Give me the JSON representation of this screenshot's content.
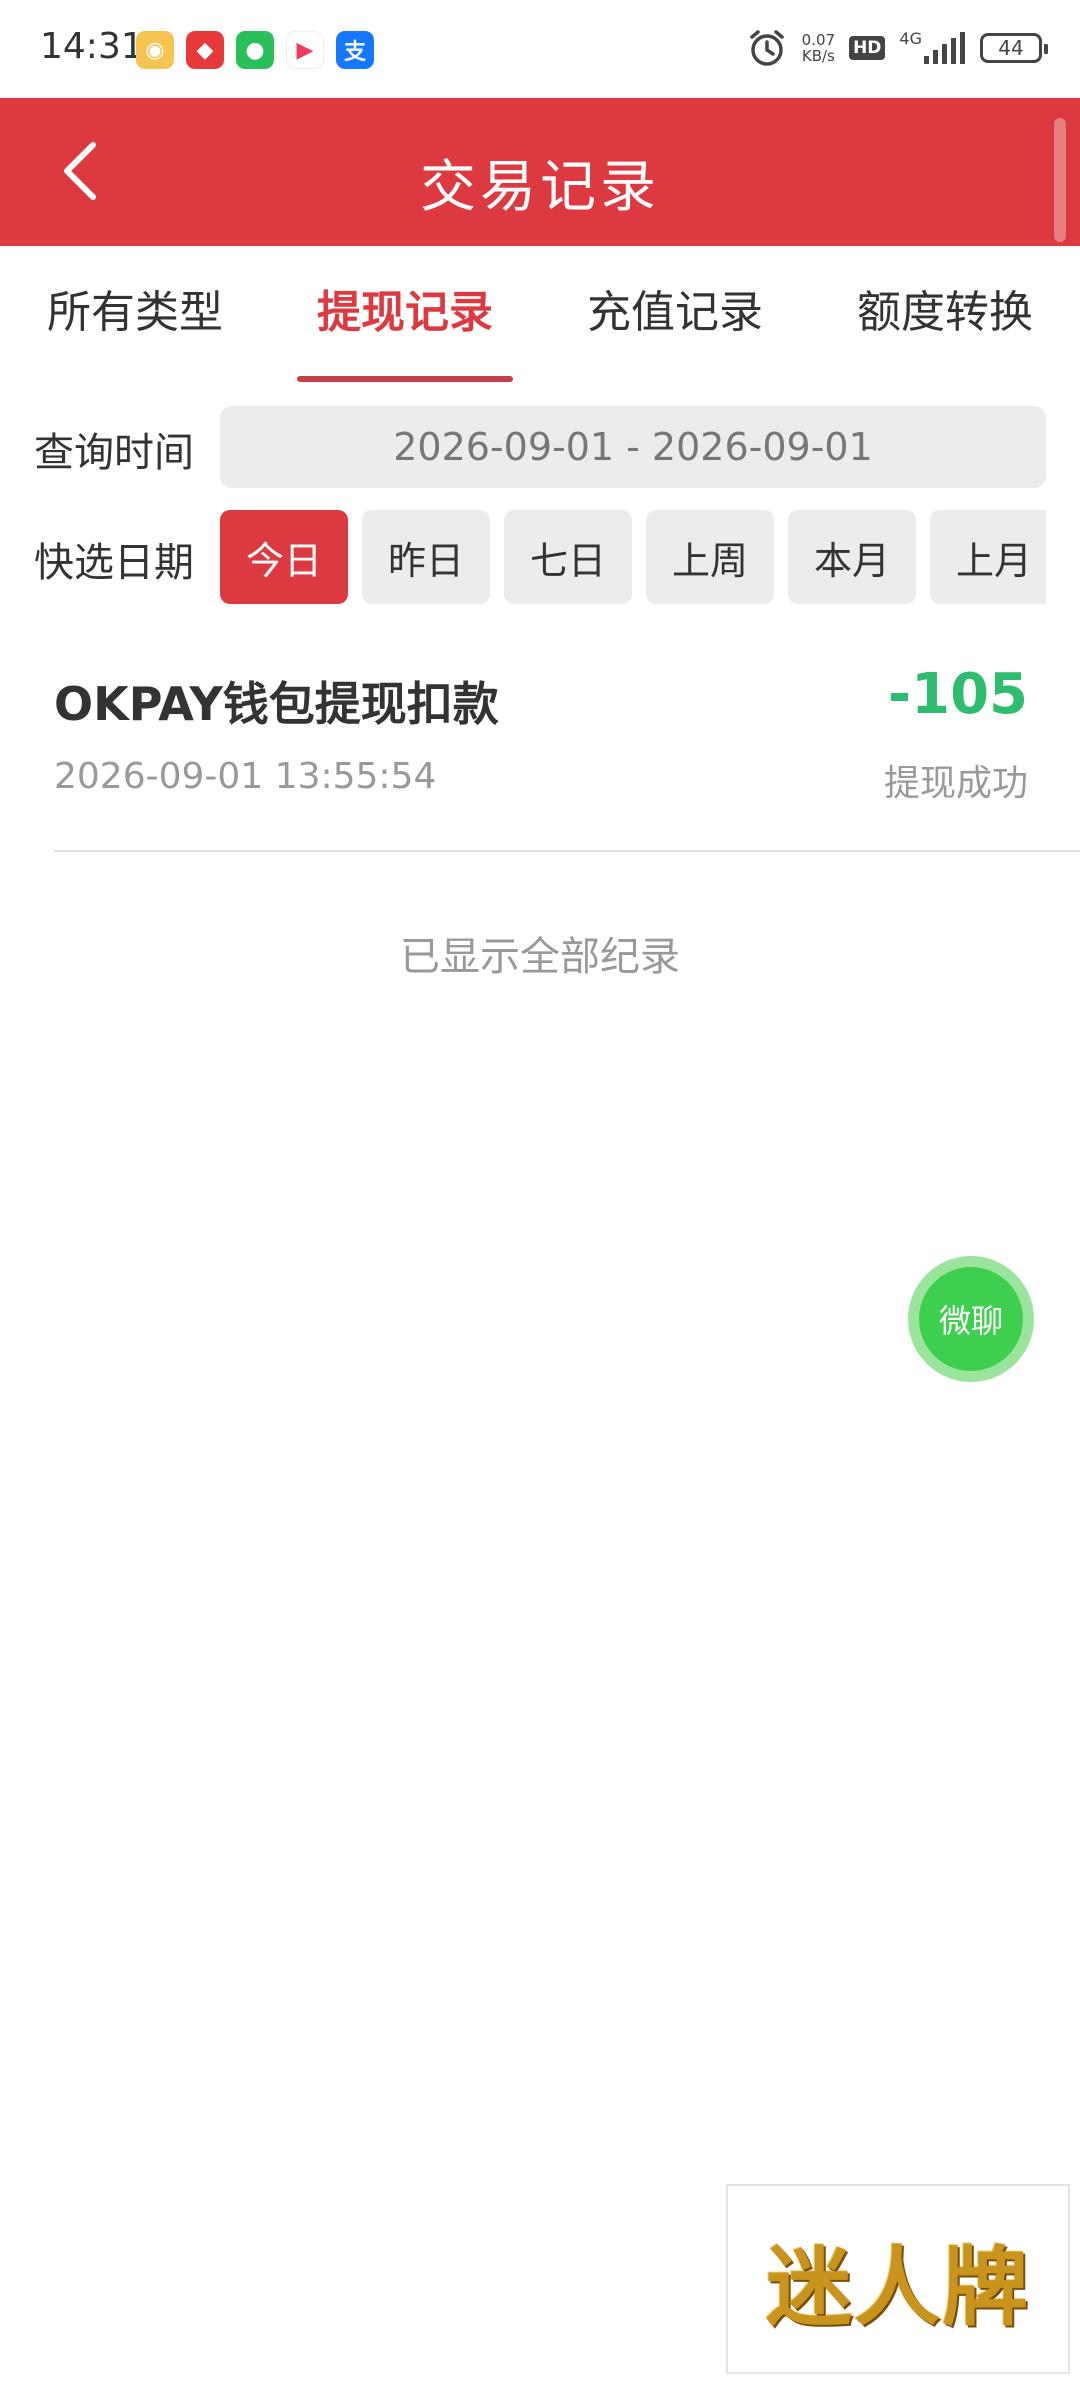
{
  "status_bar": {
    "time": "14:31",
    "apps": [
      {
        "icon": "weibo-icon",
        "color": "#f5c451",
        "glyph": "◉"
      },
      {
        "icon": "tmall-icon",
        "color": "#e8393a",
        "glyph": "◆"
      },
      {
        "icon": "wechat-icon",
        "color": "#29c05a",
        "glyph": "●"
      },
      {
        "icon": "video-app-icon",
        "color": "#f03a5b",
        "glyph": "▶"
      },
      {
        "icon": "alipay-icon",
        "color": "#1678ff",
        "glyph": "支"
      }
    ],
    "net_speed_value": "0.07",
    "net_speed_unit": "KB/s",
    "hd": "HD",
    "network": "4G",
    "battery": "44"
  },
  "header": {
    "title": "交易记录",
    "color": "#dc3a40"
  },
  "tabs": [
    {
      "label": "所有类型",
      "active": false
    },
    {
      "label": "提现记录",
      "active": true
    },
    {
      "label": "充值记录",
      "active": false
    },
    {
      "label": "额度转换",
      "active": false
    }
  ],
  "query": {
    "label": "查询时间",
    "range": "2026-09-01 - 2026-09-01"
  },
  "quick_dates": {
    "label": "快选日期",
    "options": [
      "今日",
      "昨日",
      "七日",
      "上周",
      "本月",
      "上月"
    ],
    "selected": "今日"
  },
  "records": [
    {
      "title": "OKPAY钱包提现扣款",
      "amount": "-105",
      "time": "2026-09-01 13:55:54",
      "status": "提现成功",
      "amount_color": "#2ebd6e"
    }
  ],
  "end_note": "已显示全部纪录",
  "float_button": {
    "label": "微聊",
    "color": "#3fcf4e"
  },
  "brand": {
    "text": "迷人牌"
  }
}
